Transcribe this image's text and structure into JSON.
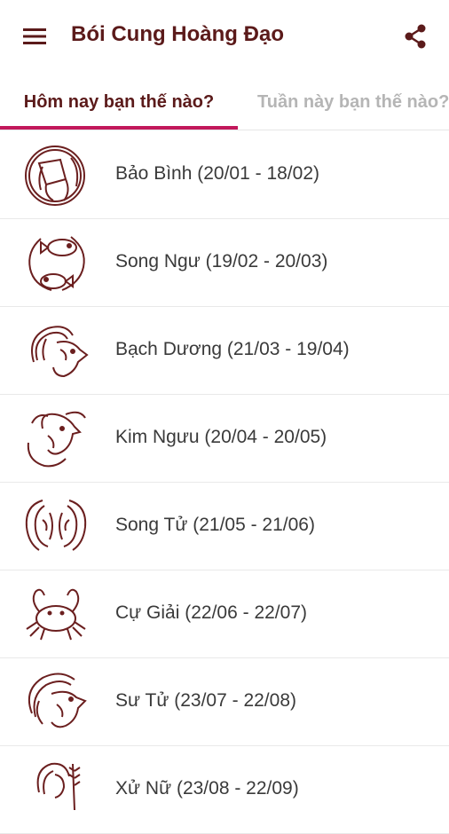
{
  "app": {
    "title": "Bói Cung Hoàng Đạo",
    "menu_icon": "hamburger-menu-icon",
    "share_icon": "share-icon"
  },
  "tabs": [
    {
      "label": "Hôm nay bạn thế nào?",
      "selected": true
    },
    {
      "label": "Tuần này bạn thế nào?",
      "selected": false
    }
  ],
  "colors": {
    "title": "#5b1a1a",
    "accent": "#c2185b",
    "icon": "#6b1f1f",
    "inactive_tab": "#b5b5b5"
  },
  "zodiac_list": [
    {
      "label": "Bảo Bình (20/01 - 18/02)",
      "icon": "aquarius-icon"
    },
    {
      "label": "Song Ngư (19/02 - 20/03)",
      "icon": "pisces-icon"
    },
    {
      "label": "Bạch Dương (21/03 - 19/04)",
      "icon": "aries-icon"
    },
    {
      "label": "Kim Ngưu (20/04 - 20/05)",
      "icon": "taurus-icon"
    },
    {
      "label": "Song Tử (21/05 - 21/06)",
      "icon": "gemini-icon"
    },
    {
      "label": "Cự Giải (22/06 - 22/07)",
      "icon": "cancer-icon"
    },
    {
      "label": "Sư Tử (23/07 - 22/08)",
      "icon": "leo-icon"
    },
    {
      "label": "Xử Nữ (23/08 - 22/09)",
      "icon": "virgo-icon"
    }
  ]
}
